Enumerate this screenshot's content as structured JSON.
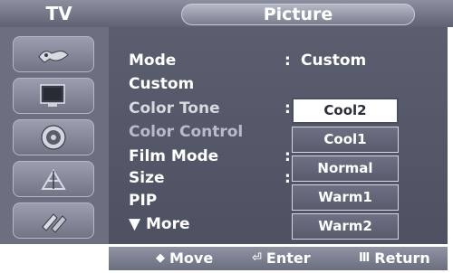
{
  "header": {
    "tv_label": "TV",
    "title": "Picture"
  },
  "sidebar": {
    "icons": [
      "input-icon",
      "picture-icon",
      "sound-icon",
      "channel-icon",
      "setup-icon"
    ]
  },
  "menu": {
    "items": [
      {
        "label": "Mode",
        "colon": ":",
        "value": "Custom"
      },
      {
        "label": "Custom"
      },
      {
        "label": "Color Tone",
        "colon": ":"
      },
      {
        "label": "Color Control"
      },
      {
        "label": "Film Mode",
        "colon": ":"
      },
      {
        "label": "Size",
        "colon": ":"
      },
      {
        "label": "PIP"
      },
      {
        "label": "More",
        "prefix": "▼"
      }
    ]
  },
  "dropdown": {
    "options": [
      "Cool2",
      "Cool1",
      "Normal",
      "Warm1",
      "Warm2"
    ],
    "selected": "Cool2"
  },
  "footer": {
    "move_icon": "◆",
    "move_label": "Move",
    "enter_icon": "⏎",
    "enter_label": "Enter",
    "return_icon": "Ⅲ",
    "return_label": "Return"
  },
  "colors": {
    "panel": "#555969",
    "header": "#7a7e8e",
    "selected_option_bg": "#ffffff"
  }
}
